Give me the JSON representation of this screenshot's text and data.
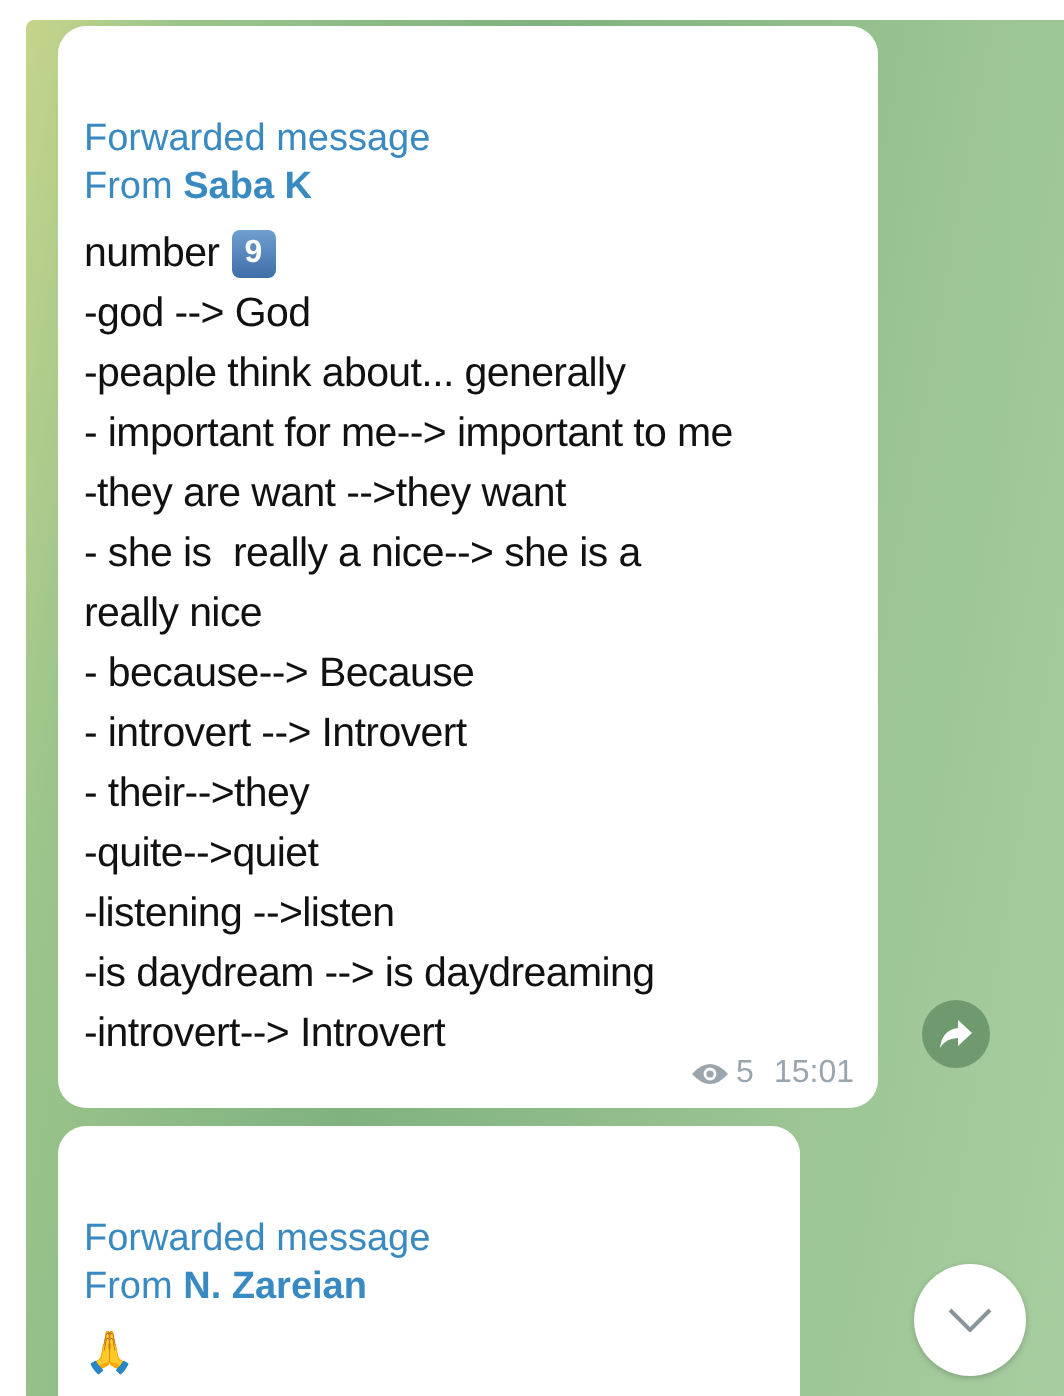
{
  "messages": [
    {
      "forwarded_label": "Forwarded message",
      "from_prefix": "From",
      "sender": "Saba K",
      "lines": [
        {
          "text": "number",
          "keycap": "9"
        },
        {
          "text": "-god --> God"
        },
        {
          "text": "-peaple think about... generally"
        },
        {
          "text": "- important for me--> important to me"
        },
        {
          "text": "-they are want -->they want"
        },
        {
          "text": "- she is  really a nice--> she is a"
        },
        {
          "text": "really nice"
        },
        {
          "text": "- because--> Because"
        },
        {
          "text": "- introvert --> Introvert"
        },
        {
          "text": "- their-->they"
        },
        {
          "text": "-quite-->quiet"
        },
        {
          "text": "-listening -->listen"
        },
        {
          "text": "-is daydream --> is daydreaming"
        },
        {
          "text": "-introvert--> Introvert"
        }
      ],
      "views": "5",
      "time": "15:01",
      "share_button": true
    },
    {
      "forwarded_label": "Forwarded message",
      "from_prefix": "From",
      "sender": "N. Zareian",
      "lines": [
        {
          "text": "🙏"
        }
      ],
      "share_button": false
    }
  ],
  "scroll_down_button": true
}
